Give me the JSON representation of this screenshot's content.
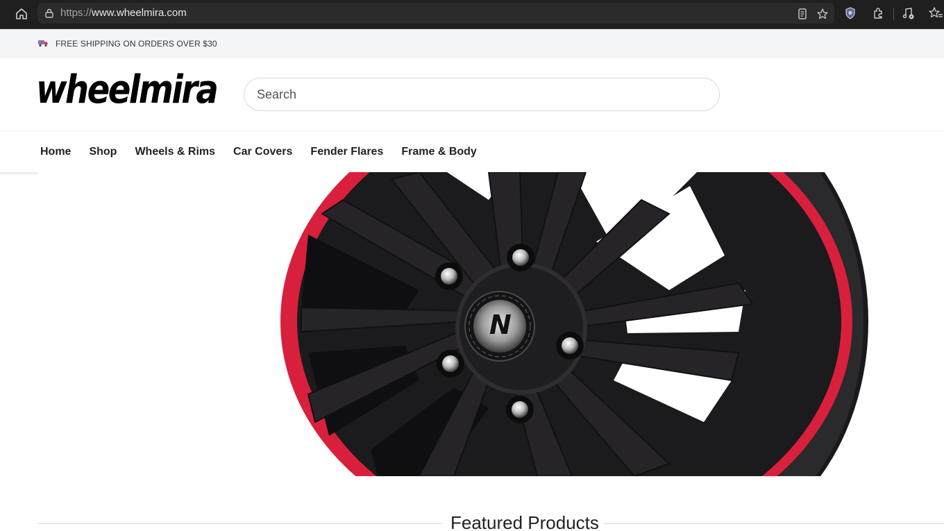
{
  "browser": {
    "url_protocol": "https://",
    "url_host": "www.wheelmira.com",
    "icons": [
      "home-icon",
      "lock-icon",
      "reader-icon",
      "star-icon",
      "shield-icon",
      "extensions-icon",
      "media-icon",
      "favorites-icon"
    ]
  },
  "announcement": {
    "icon": "truck-icon",
    "text": "FREE SHIPPING ON ORDERS OVER $30"
  },
  "header": {
    "logo_text": "wheelmira",
    "search_placeholder": "Search"
  },
  "nav": {
    "items": [
      "Home",
      "Shop",
      "Wheels & Rims",
      "Car Covers",
      "Fender Flares",
      "Frame & Body"
    ]
  },
  "hero": {
    "image": "black-alloy-wheel-red-rim",
    "hub_badge": "N"
  },
  "featured": {
    "title": "Featured Products"
  },
  "colors": {
    "chrome_dark": "#1f1f1f",
    "announce_bg": "#f4f5f7",
    "wheel_red": "#d8203c",
    "wheel_black": "#1b1a1c"
  }
}
